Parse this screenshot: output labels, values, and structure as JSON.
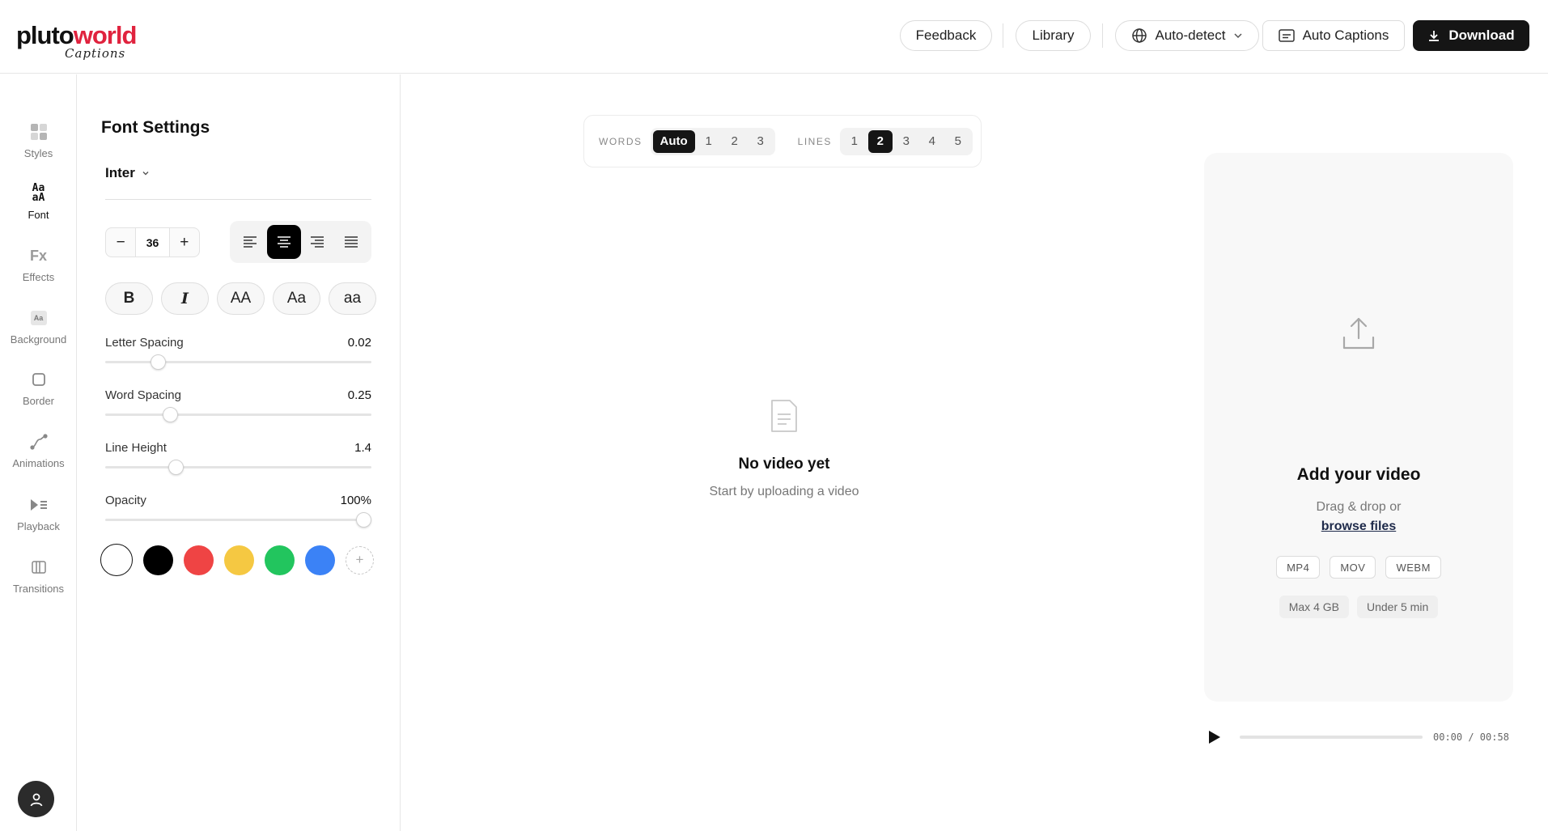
{
  "header": {
    "logo_main_a": "pluto",
    "logo_main_b": "world",
    "logo_sub": "Captions",
    "feedback_label": "Feedback",
    "library_label": "Library",
    "language_label": "Auto-detect",
    "auto_captions_label": "Auto Captions",
    "download_label": "Download"
  },
  "rail": {
    "items": [
      {
        "label": "Styles",
        "icon": "styles-icon"
      },
      {
        "label": "Font",
        "icon": "font-icon"
      },
      {
        "label": "Effects",
        "icon": "effects-icon"
      },
      {
        "label": "Background",
        "icon": "background-icon"
      },
      {
        "label": "Border",
        "icon": "border-icon"
      },
      {
        "label": "Animations",
        "icon": "animations-icon"
      },
      {
        "label": "Playback",
        "icon": "playback-icon"
      },
      {
        "label": "Transitions",
        "icon": "transitions-icon"
      }
    ],
    "active": "Font"
  },
  "panel": {
    "title": "Font Settings",
    "font_family": "Inter",
    "font_size": "36",
    "minus": "−",
    "plus": "+",
    "alignment_active": "center",
    "style_buttons": [
      "B",
      "I",
      "AA",
      "Aa",
      "aa"
    ],
    "sliders": [
      {
        "label": "Letter Spacing",
        "value": "0.02",
        "fraction": 0.18
      },
      {
        "label": "Word Spacing",
        "value": "0.25",
        "fraction": 0.23
      },
      {
        "label": "Line Height",
        "value": "1.4",
        "fraction": 0.25
      },
      {
        "label": "Opacity",
        "value": "100%",
        "fraction": 1.0
      }
    ],
    "colors": [
      "#ffffff",
      "#000000",
      "#ef4444",
      "#f5c842",
      "#22c55e",
      "#3b82f6"
    ],
    "selected_color": "#ffffff",
    "add_color": "+"
  },
  "center": {
    "words_label": "WORDS",
    "words_options": [
      "Auto",
      "1",
      "2",
      "3"
    ],
    "words_active": "Auto",
    "lines_label": "LINES",
    "lines_options": [
      "1",
      "2",
      "3",
      "4",
      "5"
    ],
    "lines_active": "2",
    "empty_title": "No video yet",
    "empty_sub": "Start by uploading a video"
  },
  "preview": {
    "title": "Add your video",
    "drag_text": "Drag & drop or",
    "browse_text": "browse files",
    "formats": [
      "MP4",
      "MOV",
      "WEBM"
    ],
    "limits": [
      "Max 4 GB",
      "Under 5 min"
    ],
    "time": "00:00 / 00:58"
  }
}
